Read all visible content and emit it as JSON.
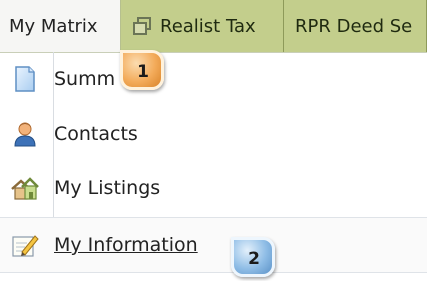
{
  "tabs": [
    {
      "label": "My Matrix",
      "active": true
    },
    {
      "label": "Realist Tax",
      "icon": "window-copy-icon"
    },
    {
      "label": "RPR Deed Se"
    }
  ],
  "menu": {
    "items": [
      {
        "label": "Summ",
        "icon": "document-icon"
      },
      {
        "label": "Contacts",
        "icon": "contact-person-icon"
      },
      {
        "label": "My Listings",
        "icon": "houses-icon"
      },
      {
        "label": "My Information",
        "icon": "edit-pencil-icon"
      }
    ]
  },
  "callouts": {
    "one": "1",
    "two": "2"
  },
  "colors": {
    "tab_green": "#c3ce8c",
    "callout_orange": "#f3ab5a",
    "callout_blue": "#8fbde6"
  }
}
